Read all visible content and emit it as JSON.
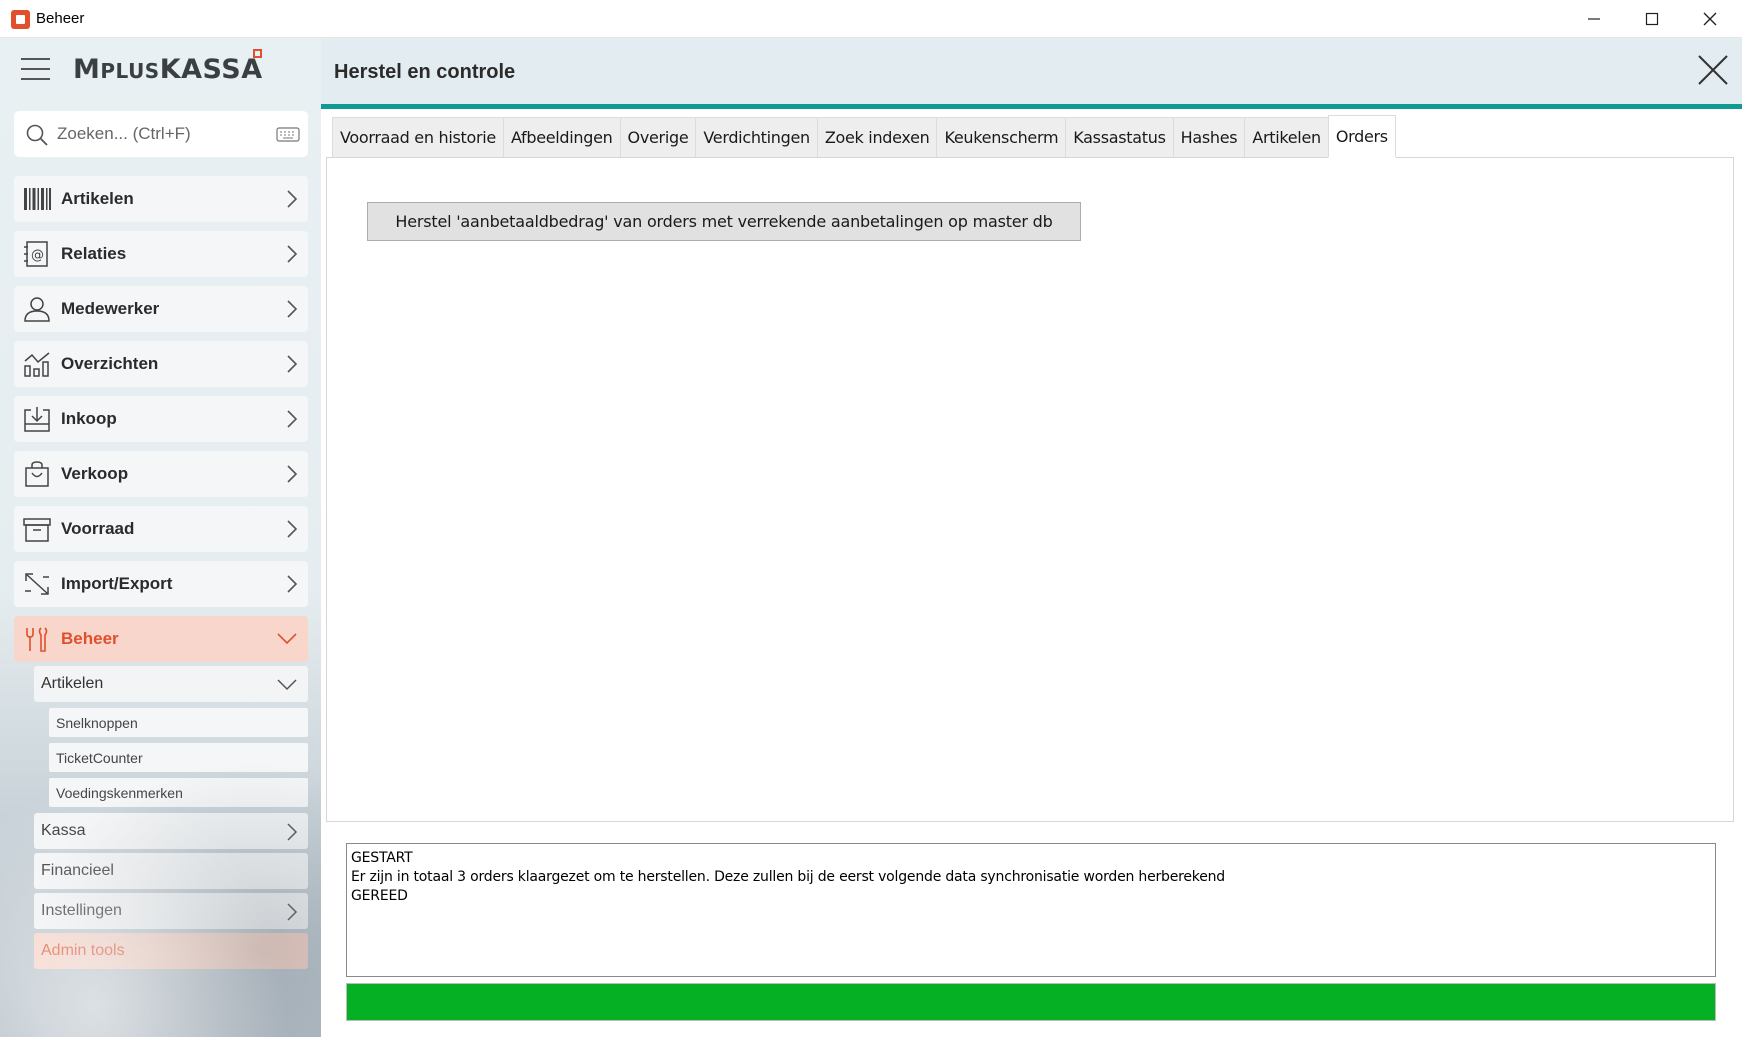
{
  "window": {
    "title": "Beheer"
  },
  "sidebar": {
    "logo": {
      "part1": "M",
      "part2": "PLUS",
      "part3": "KASSA"
    },
    "search": {
      "placeholder": "Zoeken... (Ctrl+F)"
    },
    "items": [
      {
        "label": "Artikelen",
        "icon": "barcode-icon"
      },
      {
        "label": "Relaties",
        "icon": "contacts-icon"
      },
      {
        "label": "Medewerker",
        "icon": "person-icon"
      },
      {
        "label": "Overzichten",
        "icon": "bar-chart-icon"
      },
      {
        "label": "Inkoop",
        "icon": "inbox-download-icon"
      },
      {
        "label": "Verkoop",
        "icon": "shopping-bag-icon"
      },
      {
        "label": "Voorraad",
        "icon": "archive-box-icon"
      },
      {
        "label": "Import/Export",
        "icon": "import-export-icon"
      },
      {
        "label": "Beheer",
        "icon": "tools-icon"
      }
    ],
    "beheer_sub": {
      "artikelen": {
        "label": "Artikelen",
        "children": [
          "Snelknoppen",
          "TicketCounter",
          "Voedingskenmerken"
        ]
      },
      "kassa": "Kassa",
      "financieel": "Financieel",
      "instellingen": "Instellingen",
      "admin_tools": "Admin tools"
    }
  },
  "main": {
    "title": "Herstel en controle",
    "tabs": [
      "Voorraad en historie",
      "Afbeeldingen",
      "Overige",
      "Verdichtingen",
      "Zoek indexen",
      "Keukenscherm",
      "Kassastatus",
      "Hashes",
      "Artikelen",
      "Orders"
    ],
    "selected_tab": "Orders",
    "action_button": "Herstel 'aanbetaaldbedrag' van orders met verrekende aanbetalingen op master db",
    "log": [
      "GESTART",
      "Er zijn in totaal 3 orders klaargezet om te herstellen. Deze zullen bij de eerst volgende data synchronisatie worden herberekend",
      "GEREED"
    ],
    "progress": 1.0
  },
  "colors": {
    "accent": "#e0502c",
    "teal": "#0f9a92",
    "progress_green": "#06b025"
  }
}
